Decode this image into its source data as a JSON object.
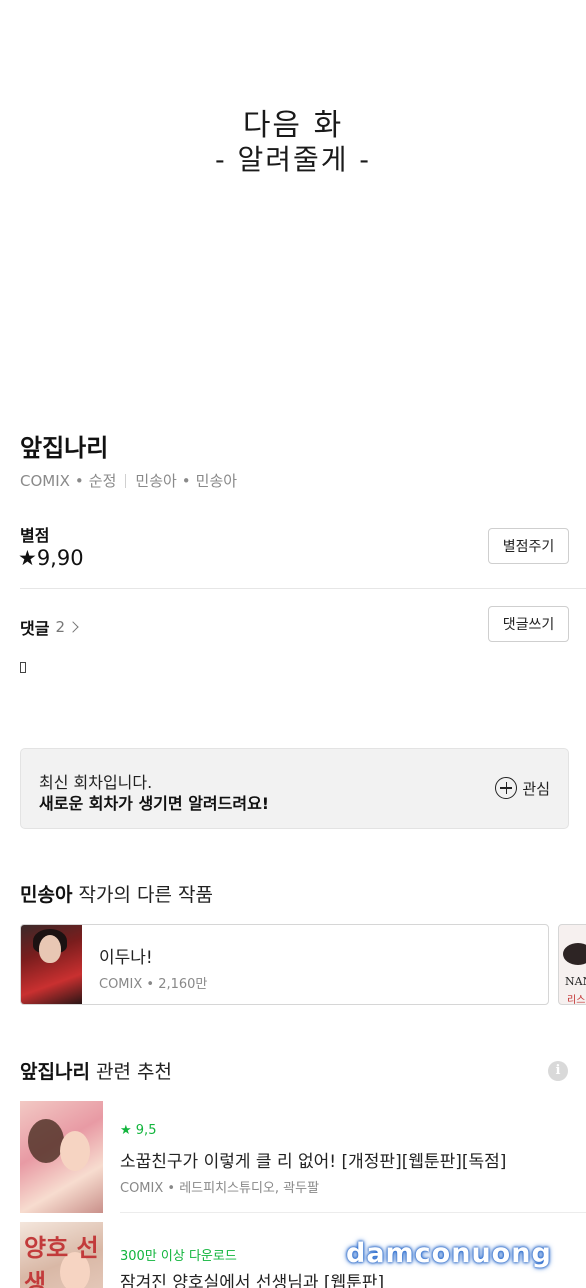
{
  "teaser": {
    "line1": "다음 화",
    "line2": "- 알려줄게 -"
  },
  "series": {
    "title": "앞집나리",
    "meta": {
      "platform": "COMIX",
      "genre": "순정",
      "writer": "민송아",
      "artist": "민송아"
    }
  },
  "rating": {
    "label": "별점",
    "value": "★9,90",
    "button": "별점주기"
  },
  "comments": {
    "label": "댓글",
    "count": "2",
    "button": "댓글쓰기"
  },
  "notice": {
    "line1": "최신 회차입니다.",
    "line2": "새로운 회차가 생기면 알려드려요!",
    "fav_label": "관심"
  },
  "author_works": {
    "name": "민송아",
    "suffix": " 작가의 다른 작품",
    "items": [
      {
        "title": "이두나!",
        "meta": "COMIX • 2,160만"
      }
    ],
    "peek": {
      "t1": "NAN",
      "t2": "리스"
    }
  },
  "recommend": {
    "name": "앞집나리",
    "suffix": " 관련 추천",
    "info_icon": "i",
    "items": [
      {
        "badge": "★ 9,5",
        "title": "소꿉친구가 이렇게 클 리 없어! [개정판][웹툰판][독점]",
        "meta": "COMIX • 레드피치스튜디오, 곽두팔",
        "thumb_text": ""
      },
      {
        "badge": "300만 이상 다운로드",
        "title": "잠겨진 양호실에서 선생님과 [웹툰판]",
        "meta": "",
        "thumb_text": "양호 선생"
      }
    ]
  },
  "watermark": "damconuong",
  "colors": {
    "accent_green": "#12b53d",
    "watermark_glow": "#2d6fd1"
  }
}
